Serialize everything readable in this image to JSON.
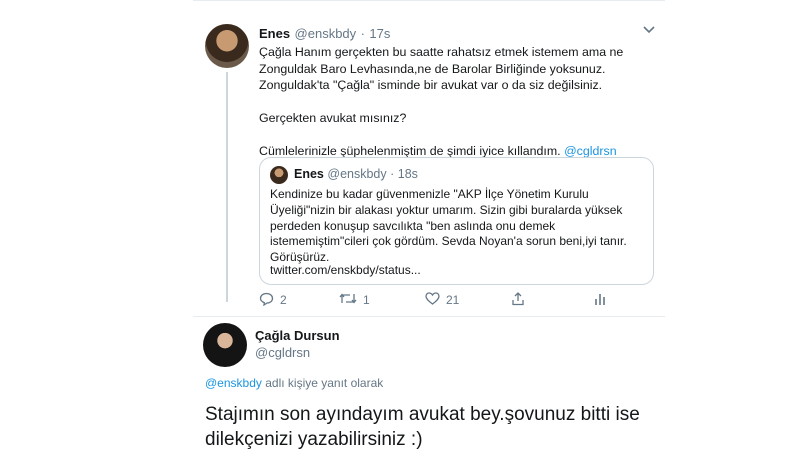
{
  "tweet": {
    "name": "Enes",
    "handle": "@enskbdy",
    "dot": "·",
    "time": "17s",
    "body_p1": "Çağla Hanım gerçekten bu saatte rahatsız etmek istemem ama ne Zonguldak Baro Levhasında,ne de Barolar Birliğinde yoksunuz. Zonguldak'ta \"Çağla\" isminde bir avukat var o da siz değilsiniz.",
    "body_p2": "Gerçekten avukat mısınız?",
    "body_p3_text": "Cümlelerinizle şüphelenmiştim de şimdi iyice kıllandım. ",
    "body_p3_mention": "@cgldrsn",
    "quote": {
      "name": "Enes",
      "handle": "@enskbdy",
      "dot": "·",
      "time": "18s",
      "text": "Kendinize bu kadar güvenmenizle \"AKP İlçe Yönetim Kurulu Üyeliği\"nizin bir alakası yoktur umarım. Sizin gibi buralarda yüksek perdeden konuşup savcılıkta \"ben aslında onu demek istememiştim\"cileri çok gördüm. Sevda Noyan'a sorun beni,iyi tanır. Görüşürüz.",
      "link": "twitter.com/enskbdy/status..."
    },
    "actions": {
      "reply_count": "2",
      "retweet_count": "1",
      "like_count": "21"
    }
  },
  "reply": {
    "name": "Çağla Dursun",
    "handle": "@cgldrsn",
    "replying_mention": "@enskbdy",
    "replying_text": " adlı kişiye yanıt olarak",
    "text": "Stajımın son ayındayım avukat bey.şovunuz bitti ise dilekçenizi yazabilirsiniz :)"
  }
}
